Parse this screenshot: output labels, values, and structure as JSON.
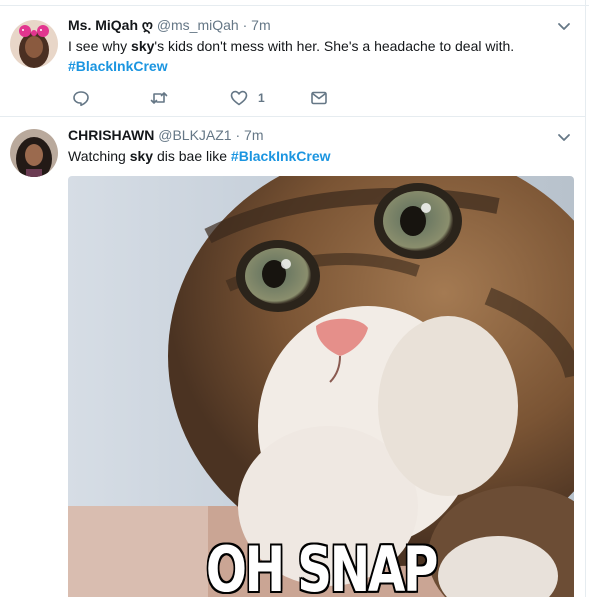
{
  "tweets": [
    {
      "display_name": "Ms. MiQah",
      "name_glyph": "ღ",
      "handle": "@ms_miQah",
      "separator": "·",
      "time": "7m",
      "text_prefix": "I see why ",
      "text_bold": "sky",
      "text_suffix": "'s kids don't mess with her. She's a headache to deal with.",
      "hashtag": "#BlackInkCrew",
      "like_count": "1",
      "icons": [
        "reply-icon",
        "retweet-icon",
        "heart-icon",
        "direct-message-icon",
        "chevron-down-icon"
      ]
    },
    {
      "display_name": "CHRISHAWN",
      "handle": "@BLKJAZ1",
      "separator": "·",
      "time": "7m",
      "text_prefix": "Watching ",
      "text_bold": "sky",
      "text_middle": " dis bae like ",
      "hashtag": "#BlackInkCrew",
      "media_caption": "OH SNAP",
      "icons": [
        "chevron-down-icon"
      ]
    }
  ],
  "colors": {
    "link_blue": "#1b95e0",
    "meta_gray": "#657786",
    "text_dark": "#14171a",
    "divider": "#e6ecf0"
  }
}
